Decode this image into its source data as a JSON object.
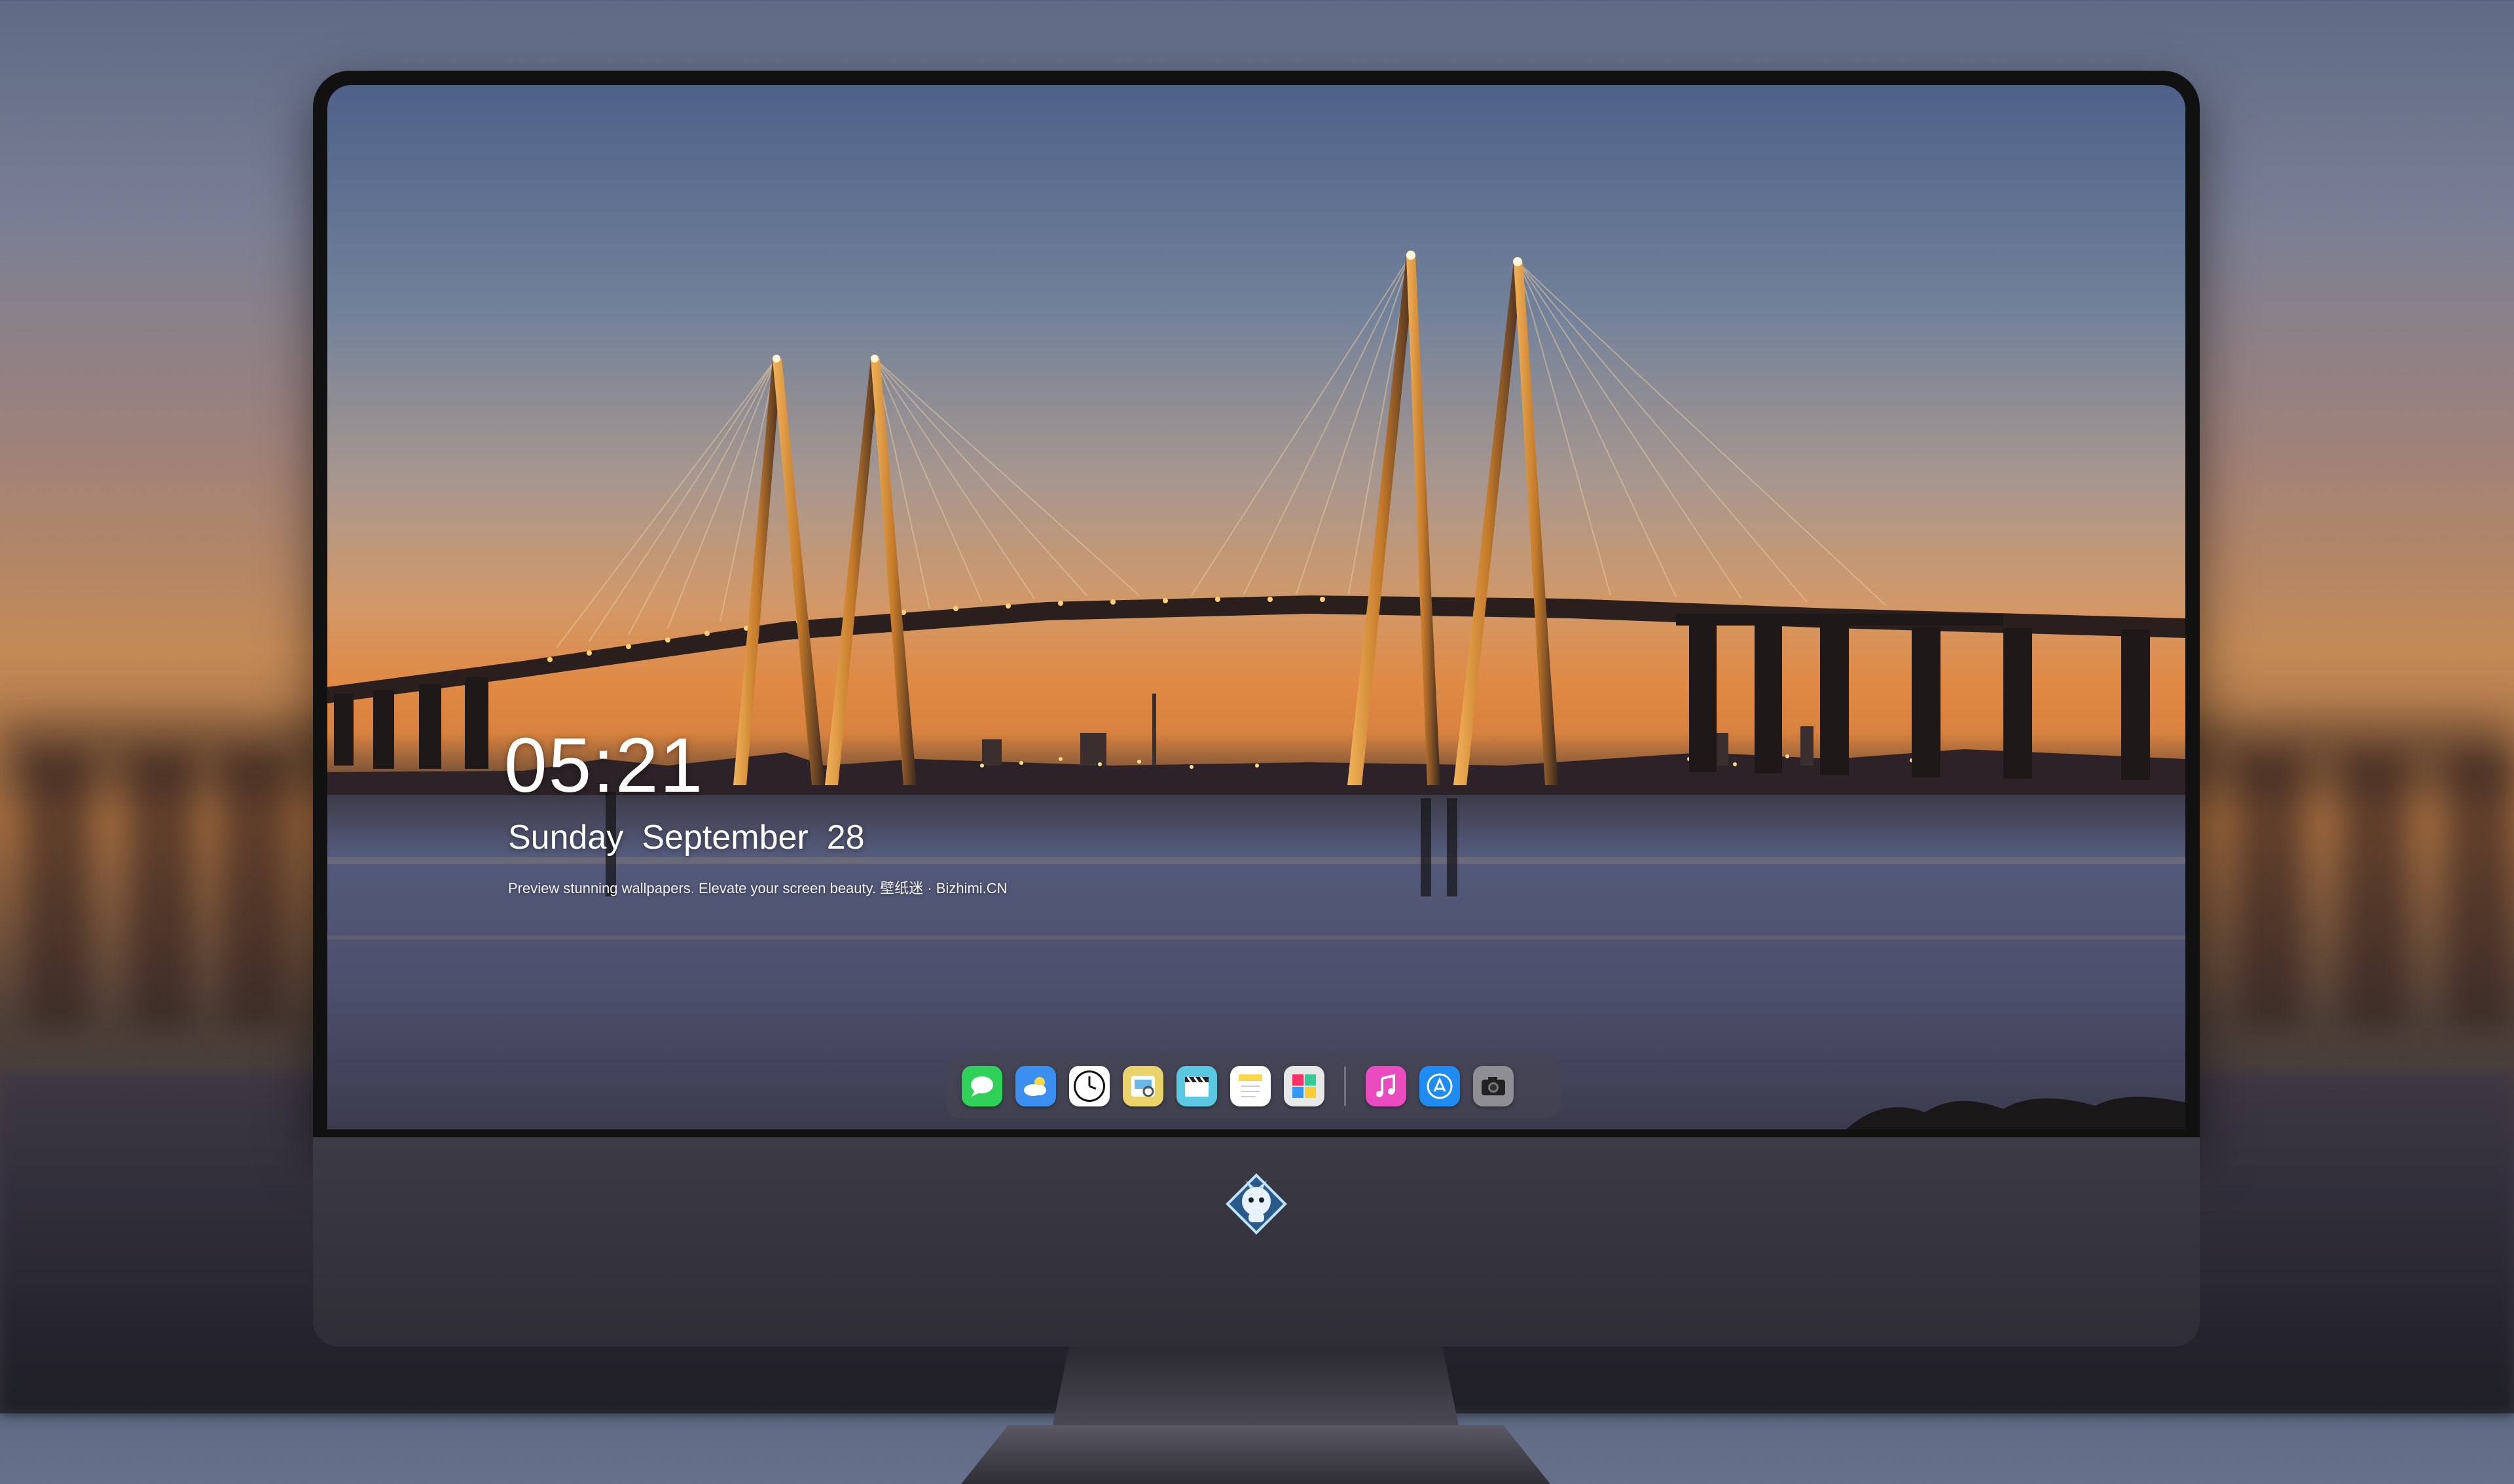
{
  "lock_screen": {
    "time": "05:21",
    "date": {
      "weekday": "Sunday",
      "month": "September",
      "day": "28"
    },
    "tagline": "Preview stunning wallpapers. Elevate your screen beauty. 壁纸迷 · Bizhimi.CN"
  },
  "dock": {
    "apps": [
      {
        "name": "messages",
        "icon": "messages-icon",
        "color": "#2fd158"
      },
      {
        "name": "weather",
        "icon": "weather-icon",
        "color": "#3a8ff0"
      },
      {
        "name": "clock",
        "icon": "clock-icon",
        "color": "#ffffff"
      },
      {
        "name": "preview",
        "icon": "preview-icon",
        "color": "#e9d36a"
      },
      {
        "name": "clips",
        "icon": "clapperboard-icon",
        "color": "#5ac8e0"
      },
      {
        "name": "notes",
        "icon": "notes-icon",
        "color": "#ffd84a"
      },
      {
        "name": "photo-booth",
        "icon": "photo-booth-icon",
        "color": "#e7e7e7"
      },
      {
        "name": "music",
        "icon": "music-icon",
        "color": "#ea4cc0"
      },
      {
        "name": "app-store",
        "icon": "app-store-icon",
        "color": "#1f8cf4"
      },
      {
        "name": "camera",
        "icon": "camera-icon",
        "color": "#8e8e93"
      }
    ]
  },
  "colors": {
    "sky_top": "#4e6189",
    "sunset": "#e08a45",
    "bridge_lights": "#ffd27a",
    "water": "#4c4d66"
  }
}
